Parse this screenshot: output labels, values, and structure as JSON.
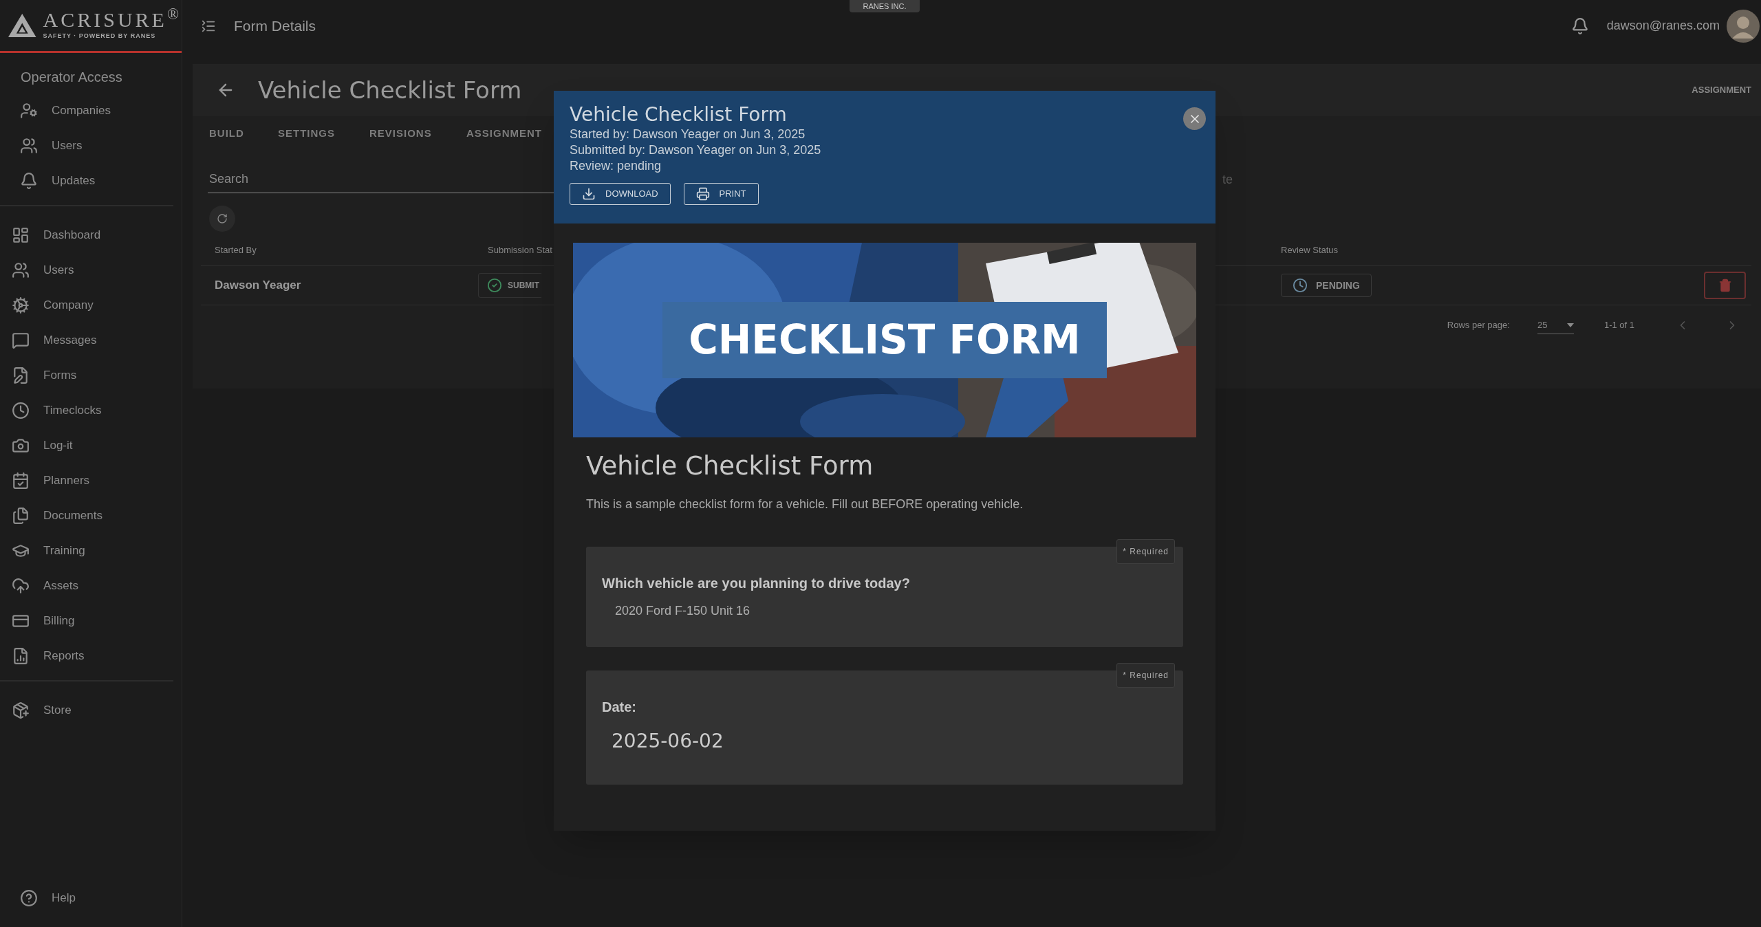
{
  "app": {
    "logo_name": "ACRISURE$^{®}$",
    "logo_tagline": "SAFETY · POWERED BY RANES",
    "page_title": "Form Details",
    "company_badge": "RANES INC.",
    "user_email": "dawson@ranes.com"
  },
  "sidebar": {
    "heading": "Operator Access",
    "groups": [
      [
        "Companies",
        "Users",
        "Updates"
      ],
      [
        "Dashboard",
        "Users",
        "Company",
        "Messages",
        "Forms",
        "Timeclocks",
        "Log-it",
        "Planners",
        "Documents",
        "Training",
        "Assets",
        "Billing",
        "Reports"
      ],
      [
        "Store"
      ]
    ],
    "footer_item": "Help"
  },
  "page": {
    "title": "Vehicle Checklist Form",
    "tabs": [
      "BUILD",
      "SETTINGS",
      "REVISIONS",
      "ASSIGNMENT"
    ],
    "overflow_tab": "ASSIGNMENT",
    "search": {
      "placeholder": "Search"
    },
    "field_2_label": "te",
    "table": {
      "columns": [
        "Started By",
        "Submission Stat",
        "Review Status"
      ],
      "rows": [
        {
          "started_by": "Dawson Yeager",
          "submission_status": "SUBMIT",
          "review_status": "PENDING"
        }
      ]
    },
    "pagination": {
      "rows_label": "Rows per page:",
      "rows_value": "25",
      "range": "1-1 of 1"
    }
  },
  "modal": {
    "title": "Vehicle Checklist Form",
    "meta_lines": [
      "Started by: Dawson Yeager on Jun 3, 2025",
      "Submitted by: Dawson Yeager on Jun 3, 2025",
      "Review: pending"
    ],
    "buttons": [
      {
        "kind": "download",
        "label": "DOWNLOAD"
      },
      {
        "kind": "print",
        "label": "PRINT"
      }
    ],
    "banner_text": "CHECKLIST FORM",
    "form_title": "Vehicle Checklist Form",
    "form_description": "This is a sample checklist form for a vehicle. Fill out BEFORE operating vehicle.",
    "questions": [
      {
        "kind": "text",
        "label": "Which vehicle are you planning to drive today?",
        "answer": "2020 Ford F-150 Unit 16",
        "required_tag": "* Required"
      },
      {
        "kind": "date",
        "label": "Date:",
        "answer": "2025-06-02",
        "required_tag": "* Required"
      }
    ]
  }
}
